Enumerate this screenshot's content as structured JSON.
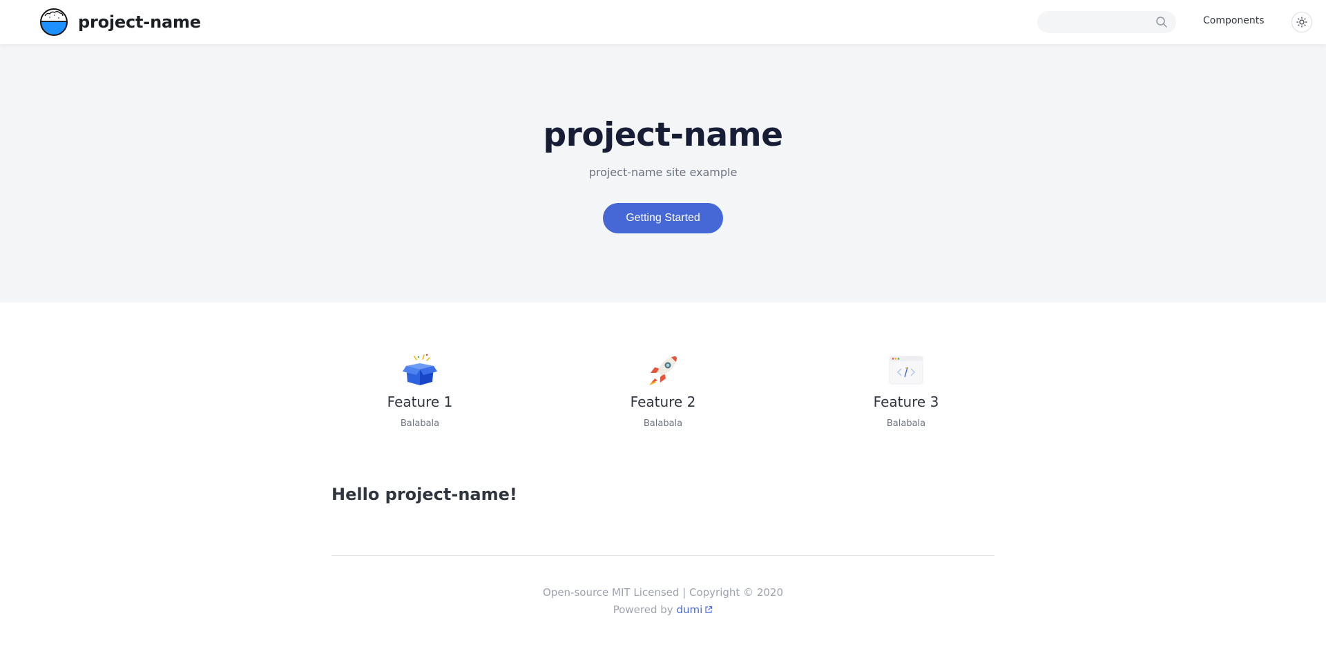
{
  "header": {
    "brand_name": "project-name",
    "search_placeholder": "",
    "nav": [
      {
        "label": "Components"
      }
    ]
  },
  "hero": {
    "title": "project-name",
    "description": "project-name site example",
    "button_label": "Getting Started",
    "button_color": "#4568d6",
    "background": "#f4f5f7"
  },
  "features": [
    {
      "icon": "box-icon",
      "title": "Feature 1",
      "desc": "Balabala"
    },
    {
      "icon": "rocket-icon",
      "title": "Feature 2",
      "desc": "Balabala"
    },
    {
      "icon": "code-window-icon",
      "title": "Feature 3",
      "desc": "Balabala"
    }
  ],
  "content": {
    "heading": "Hello project-name!"
  },
  "footer": {
    "line1": "Open-source MIT Licensed | Copyright © 2020",
    "powered_prefix": "Powered by",
    "powered_link": "dumi"
  }
}
